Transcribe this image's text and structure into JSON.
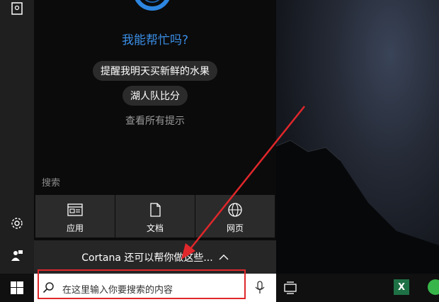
{
  "cortana": {
    "prompt": "我能帮忙吗?",
    "suggestions": [
      "提醒我明天买新鲜的水果",
      "湖人队比分"
    ],
    "view_all": "查看所有提示"
  },
  "search": {
    "heading": "搜索",
    "categories": [
      {
        "label": "应用",
        "icon": "app-window-icon"
      },
      {
        "label": "文档",
        "icon": "document-icon"
      },
      {
        "label": "网页",
        "icon": "globe-icon"
      }
    ],
    "more_text": "Cortana 还可以帮你做这些...",
    "placeholder": "在这里输入你要搜索的内容"
  },
  "colors": {
    "accent": "#3a8ee6",
    "highlight": "#e0272b"
  },
  "taskbar": {
    "excel_letter": "X"
  }
}
